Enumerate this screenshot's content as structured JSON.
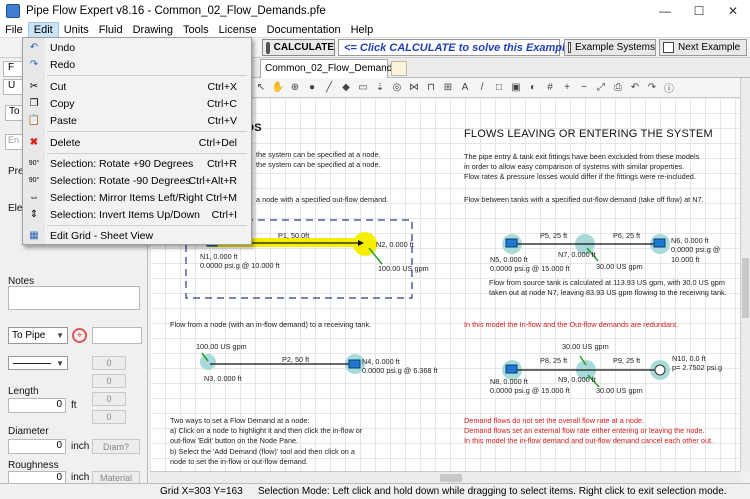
{
  "window": {
    "title": "Pipe Flow Expert v8.16 - Common_02_Flow_Demands.pfe",
    "controls": [
      "—",
      "☐",
      "✕"
    ]
  },
  "menubar": {
    "items": [
      "File",
      "Edit",
      "Units",
      "Fluid",
      "Drawing",
      "Tools",
      "License",
      "Documentation",
      "Help"
    ],
    "active": "Edit"
  },
  "toolbar": {
    "calculate_label": "CALCULATE",
    "calculate_hint": "<= Click CALCULATE to solve this Example.",
    "example_systems_label": "Example Systems",
    "next_example_label": "Next Example"
  },
  "document_tab": {
    "label": "Common_02_Flow_Demands",
    "close": "X"
  },
  "edit_menu": {
    "items": [
      {
        "label": "Undo",
        "shortcut": "",
        "icon": "undo-icon"
      },
      {
        "label": "Redo",
        "shortcut": "",
        "icon": "redo-icon"
      },
      {
        "label": "Cut",
        "shortcut": "Ctrl+X",
        "icon": "cut-icon"
      },
      {
        "label": "Copy",
        "shortcut": "Ctrl+C",
        "icon": "copy-icon"
      },
      {
        "label": "Paste",
        "shortcut": "Ctrl+V",
        "icon": "paste-icon"
      },
      {
        "label": "Delete",
        "shortcut": "Ctrl+Del",
        "icon": "delete-icon"
      },
      {
        "label": "Selection: Rotate +90 Degrees",
        "shortcut": "Ctrl+R",
        "icon": "rotate-plus-icon",
        "badge": "90°"
      },
      {
        "label": "Selection: Rotate -90 Degrees",
        "shortcut": "Ctrl+Alt+R",
        "icon": "rotate-minus-icon",
        "badge": "90°"
      },
      {
        "label": "Selection: Mirror Items Left/Right",
        "shortcut": "Ctrl+M",
        "icon": "mirror-icon"
      },
      {
        "label": "Selection: Invert Items Up/Down",
        "shortcut": "Ctrl+I",
        "icon": "invert-icon"
      },
      {
        "label": "Edit Grid - Sheet View",
        "shortcut": "",
        "icon": "grid-icon"
      }
    ]
  },
  "left_panel": {
    "fragments": [
      "F",
      "U",
      "To",
      "Pre",
      "Eleva",
      "En"
    ],
    "notes_label": "Notes",
    "to_pipe": "To Pipe",
    "length_label": "Length",
    "length_value": "0",
    "length_unit": "ft",
    "diameter_label": "Diameter",
    "diameter_value": "0",
    "diameter_unit": "inch",
    "diam_button": "Diam?",
    "roughness_label": "Roughness",
    "roughness_value": "0",
    "roughness_unit": "inch",
    "material_button": "Material",
    "counters": [
      "0",
      "0",
      "0",
      "0"
    ]
  },
  "canvas": {
    "heading_left": "NDS",
    "heading_right": "FLOWS LEAVING OR ENTERING THE SYSTEM",
    "left_intro": [
      "the system can be specified at a node.",
      "the system can be specified at a node."
    ],
    "left_sub1": "a node with a specified out-flow demand.",
    "right_intro": [
      "The pipe entry & tank exit fittings have been excluded from these models",
      "in order to allow easy comparison of systems with similar properties.",
      "Flow rates & pressure losses would differ if the fittings were re-included."
    ],
    "right_sub1": "Flow between tanks with a specified out-flow demand (take off flow) at N7.",
    "right_note": [
      "Flow from source tank is calculated at 113.93 US gpm, with 30.0 US gpm",
      "taken out at node N7, leaving 83.93 US gpm flowing to the receiving tank."
    ],
    "left_sub2": "Flow from a node (with an in-flow demand) to a receiving tank.",
    "right_sub2": "In this model the In-flow and the Out-flow demands are redundant.",
    "two_ways": [
      "Two ways to set a Flow Demand at a node:",
      "a)  Click on a node to highlight it and then click the in-flow or",
      "     out-flow 'Edit' button on the Node Pane.",
      "b)  Select the 'Add Demand (flow)' tool and then click on a",
      "     node to set the in-flow or out-flow demand."
    ],
    "right_red": [
      "Demand flows do not set the overall flow rate at a node.",
      "Demand flows set an external flow rate either entering or leaving the node.",
      "In this model the in-flow demand and out-flow demand cancel each other out."
    ],
    "labels": {
      "p1": "P1, 50.0ft",
      "n1": "N1, 0.000 ft",
      "n1b": "0.0000 psi.g @ 10.000 ft",
      "n2": "N2, 0.000 ft",
      "d1": "100.00 US gpm",
      "p5": "P5, 25 ft",
      "n5": "N5, 0.000 ft",
      "n5b": "0.0000 psi.g @ 15.000 ft",
      "n7": "N7, 0.000 ft",
      "p6": "P6, 25 ft",
      "n6": "N6, 0.000 ft",
      "n6b": "0.0000 psi.g @ 10.000 ft",
      "d2": "30.00 US gpm",
      "d3": "100.00 US gpm",
      "n3": "N3, 0.000 ft",
      "p2": "P2, 50 ft",
      "n4": "N4, 0.000 ft",
      "n4b": "0.0000 psi.g @ 6.368 ft",
      "d4": "30.00 US gpm",
      "p8": "P8, 25 ft",
      "p9": "P9, 25 ft",
      "n8": "N8, 0.000 ft",
      "n8b": "0.0000 psi.g @ 15.000 ft",
      "n9": "N9, 0.000 ft",
      "n10": "N10, 0.0 ft",
      "n10b": "p= 2.7502 psi.g",
      "d5": "30.00 US gpm"
    }
  },
  "statusbar": {
    "grid": "Grid  X=303  Y=163",
    "mode": "Selection Mode: Left click and hold down while dragging to select items. Right click to exit selection mode."
  },
  "colors": {
    "highlight": "#f5ee00",
    "pipe_flow": "#2a9a2a",
    "node_halo": "#a9dada",
    "red_text": "#d21c1c",
    "calc_hint_blue": "#1f3fb5"
  }
}
